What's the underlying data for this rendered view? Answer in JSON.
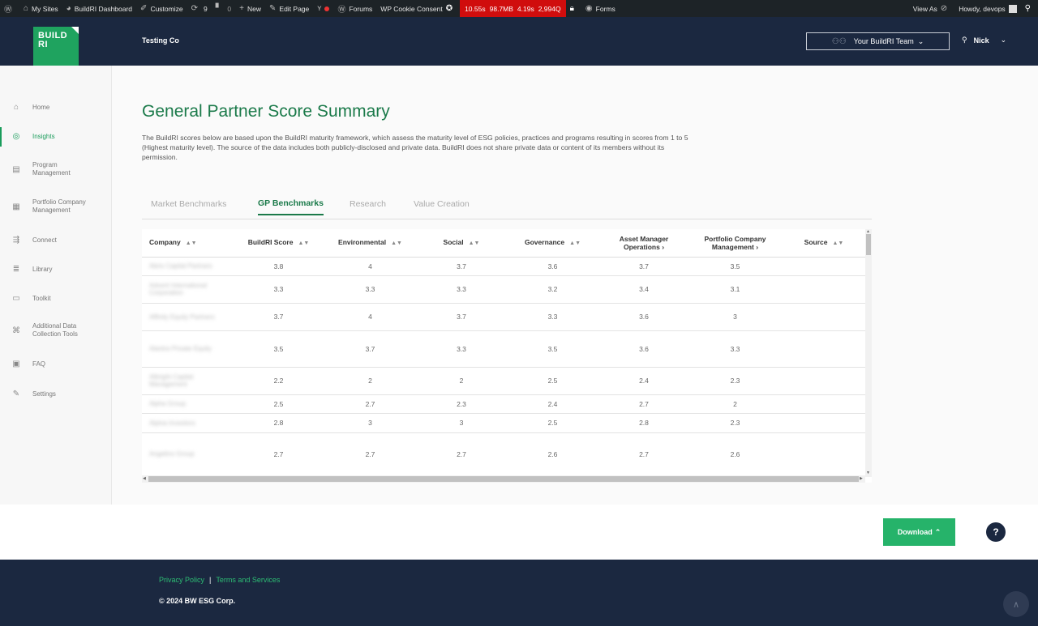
{
  "wpbar": {
    "my_sites": "My Sites",
    "dashboard": "BuildRI Dashboard",
    "customize": "Customize",
    "updates_count": "9",
    "comments_count": "0",
    "new": "New",
    "edit_page": "Edit Page",
    "forums": "Forums",
    "cookie_consent": "WP Cookie Consent",
    "perf": [
      "10.55s",
      "98.7MB",
      "4.19s",
      "2,994Q"
    ],
    "forms": "Forms",
    "view_as": "View As",
    "howdy": "Howdy, devops"
  },
  "header": {
    "logo_line1": "BUILD",
    "logo_line2": "RI",
    "org_name": "Testing Co",
    "team_select": "Your BuildRI Team",
    "user_name": "Nick"
  },
  "sidebar": {
    "items": [
      {
        "label": "Home",
        "icon": "home-icon",
        "glyph": "⌂"
      },
      {
        "label": "Insights",
        "icon": "globe-icon",
        "glyph": "◎"
      },
      {
        "label": "Program Management",
        "icon": "program-icon",
        "glyph": "▤"
      },
      {
        "label": "Portfolio Company Management",
        "icon": "portfolio-icon",
        "glyph": "▦"
      },
      {
        "label": "Connect",
        "icon": "connect-icon",
        "glyph": "⇶"
      },
      {
        "label": "Library",
        "icon": "library-icon",
        "glyph": "≣"
      },
      {
        "label": "Toolkit",
        "icon": "toolkit-icon",
        "glyph": "▭"
      },
      {
        "label": "Additional Data Collection Tools",
        "icon": "command-icon",
        "glyph": "⌘"
      },
      {
        "label": "FAQ",
        "icon": "faq-icon",
        "glyph": "▣"
      },
      {
        "label": "Settings",
        "icon": "wrench-icon",
        "glyph": "✎"
      }
    ]
  },
  "main": {
    "title": "General Partner Score Summary",
    "intro": "The BuildRI scores below are based upon the BuildRI maturity framework, which assess the maturity level of ESG policies, practices and programs resulting in scores from 1 to 5 (Highest maturity level). The source of the data includes both publicly-disclosed and private data. BuildRI does not share private data or content of its members without its permission.",
    "tabs": [
      "Market Benchmarks",
      "GP Benchmarks",
      "Research",
      "Value Creation"
    ],
    "active_tab": "GP Benchmarks"
  },
  "table": {
    "columns": [
      {
        "label": "Company",
        "sort": true
      },
      {
        "label": "BuildRI Score",
        "sort": true
      },
      {
        "label": "Environmental",
        "sort": true
      },
      {
        "label": "Social",
        "sort": true
      },
      {
        "label": "Governance",
        "sort": true
      },
      {
        "label": "Asset Manager Operations ›",
        "sort": false
      },
      {
        "label": "Portfolio Company Management ›",
        "sort": false
      },
      {
        "label": "Source",
        "sort": true
      }
    ],
    "rows": [
      {
        "company": "Abris Capital Partners",
        "values": [
          "3.8",
          "4",
          "3.7",
          "3.6",
          "3.7",
          "3.5",
          ""
        ]
      },
      {
        "company": "Advent International Corporation",
        "values": [
          "3.3",
          "3.3",
          "3.3",
          "3.2",
          "3.4",
          "3.1",
          ""
        ]
      },
      {
        "company": "Affinity Equity Partners",
        "values": [
          "3.7",
          "4",
          "3.7",
          "3.3",
          "3.6",
          "3",
          ""
        ]
      },
      {
        "company": "Alantra Private Equity",
        "values": [
          "3.5",
          "3.7",
          "3.3",
          "3.5",
          "3.6",
          "3.3",
          ""
        ]
      },
      {
        "company": "Albright Capital Management",
        "values": [
          "2.2",
          "2",
          "2",
          "2.5",
          "2.4",
          "2.3",
          ""
        ]
      },
      {
        "company": "Alpha Group",
        "values": [
          "2.5",
          "2.7",
          "2.3",
          "2.4",
          "2.7",
          "2",
          ""
        ]
      },
      {
        "company": "Alpina Investors",
        "values": [
          "2.8",
          "3",
          "3",
          "2.5",
          "2.8",
          "2.3",
          ""
        ]
      },
      {
        "company": "Angelino Group",
        "values": [
          "2.7",
          "2.7",
          "2.7",
          "2.6",
          "2.7",
          "2.6",
          ""
        ]
      }
    ]
  },
  "actions": {
    "download": "Download",
    "help": "?"
  },
  "footer": {
    "privacy": "Privacy Policy",
    "terms": "Terms and Services",
    "copyright": "© 2024 BW ESG Corp."
  }
}
